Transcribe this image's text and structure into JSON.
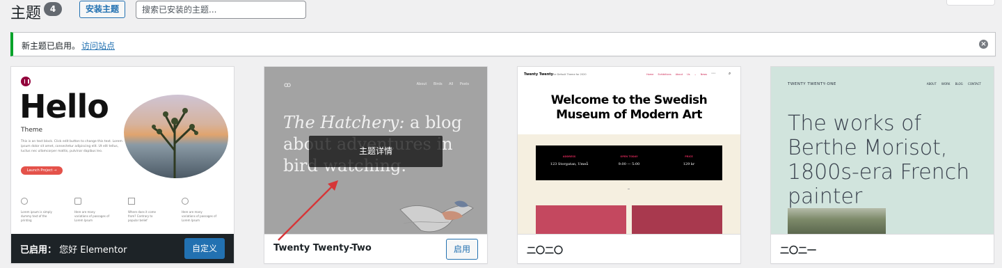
{
  "header": {
    "title": "主题",
    "count": "4",
    "install_label": "安装主题",
    "search_placeholder": "搜索已安装的主题..."
  },
  "notice": {
    "text": "新主题已启用。",
    "link": "访问站点"
  },
  "themes": [
    {
      "name_prefix": "已启用：",
      "name": "您好 Elementor",
      "button": "自定义",
      "active": true,
      "preview": {
        "headline": "Hello",
        "subtitle": "Theme",
        "body": "This is an text block. Click edit button to change this text. Lorem ipsum dolor sit amet, consectetur adipiscing elit. Ut elit tellus, luctus nec ullamcorper mattis, pulvinar dapibus leo.",
        "cta": "Launch Project →",
        "features": [
          "Lorem ipsum is simply dummy text of the printing",
          "Here are many variations of passages of Lorem Ipsum",
          "Where does it come from? Contrary to popular belief",
          "Here are many variations of passages of Lorem Ipsum"
        ]
      }
    },
    {
      "name": "Twenty Twenty-Two",
      "button": "启用",
      "active": false,
      "details_label": "主题详情",
      "preview": {
        "logo": "ꝏ",
        "nav": "About Birds All Posts",
        "title_italic": "The Hatchery:",
        "title_rest": " a blog about adventures in bird watching."
      }
    },
    {
      "name": "二〇二〇",
      "active": false,
      "preview": {
        "brand": "Twenty Twenty",
        "tagline": "The Default Theme for 2020",
        "nav": "Home Exhibitions About Us ⌄ News",
        "headline": "Welcome to the Swedish Museum of Modern Art",
        "info": [
          {
            "label": "ADDRESS",
            "value": "123 Storgatan, Umeå"
          },
          {
            "label": "OPEN TODAY",
            "value": "9:00 — 5:00"
          },
          {
            "label": "PRICE",
            "value": "129 kr"
          }
        ]
      }
    },
    {
      "name": "二〇二一",
      "active": false,
      "preview": {
        "brand": "TWENTY TWENTY-ONE",
        "nav": "ABOUT WORK BLOG CONTACT",
        "headline": "The works of Berthe Morisot, 1800s-era French painter"
      }
    }
  ],
  "colors": {
    "accent": "#2271b1",
    "success": "#00a32a",
    "active_footer": "#1d2327"
  }
}
